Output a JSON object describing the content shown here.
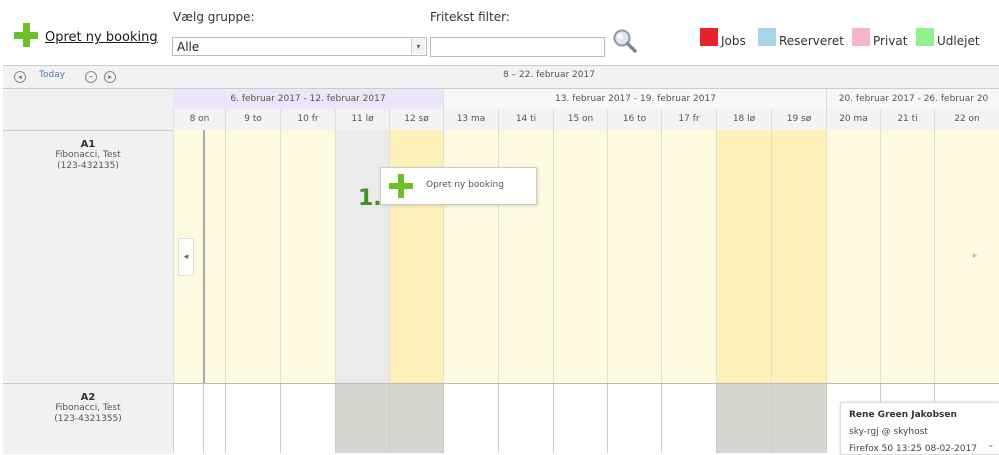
{
  "toolbar": {
    "create_label": "Opret ny booking",
    "group_label": "Vælg gruppe:",
    "group_value": "Alle",
    "filter_label": "Fritekst filter:",
    "filter_value": ""
  },
  "legend": [
    {
      "label": "Jobs",
      "color": "#e8212b"
    },
    {
      "label": "Reserveret",
      "color": "#a6d6ea"
    },
    {
      "label": "Privat",
      "color": "#f5b6cd"
    },
    {
      "label": "Udlejet",
      "color": "#8ff28c"
    }
  ],
  "nav": {
    "today_label": "Today",
    "range_label": "8 – 22. februar 2017"
  },
  "weeks": [
    "6. februar 2017 - 12. februar 2017",
    "13. februar 2017 - 19. februar 2017",
    "20. februar 2017 - 26. februar 20"
  ],
  "days": [
    "8 on",
    "9 to",
    "10 fr",
    "11 lø",
    "12 sø",
    "13 ma",
    "14 ti",
    "15 on",
    "16 to",
    "17 fr",
    "18 lø",
    "19 sø",
    "20 ma",
    "21 ti",
    "22 on"
  ],
  "rows": [
    {
      "name": "A1",
      "owner": "Fibonacci, Test",
      "phone": "(123-432135)"
    },
    {
      "name": "A2",
      "owner": "Fibonacci, Test",
      "phone": "(123-4321355)"
    }
  ],
  "popup": {
    "step_label": "1.",
    "create_label": "Opret ny booking"
  },
  "user_card": {
    "name": "Rene Green Jakobsen",
    "account": "sky-rgj @ skyhost",
    "session": "Firefox 50 13:25 08-02-2017"
  }
}
